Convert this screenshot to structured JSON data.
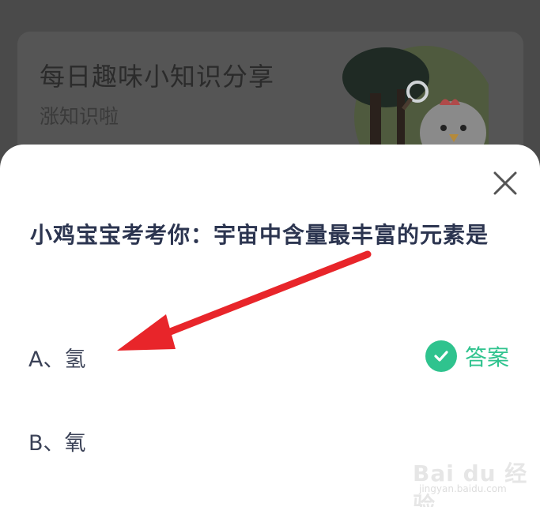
{
  "background_card": {
    "title": "每日趣味小知识分享",
    "subtitle": "涨知识啦"
  },
  "modal": {
    "question": "小鸡宝宝考考你：宇宙中含量最丰富的元素是",
    "options": [
      {
        "label": "A、氢"
      },
      {
        "label": "B、氧"
      }
    ],
    "answer_label": "答案",
    "close_icon": "close-icon",
    "accent_color": "#2fc38e"
  },
  "annotation": {
    "arrow_color": "#e8252a"
  },
  "watermark": {
    "brand": "Bai du 经验",
    "url": "jingyan.baidu.com"
  }
}
